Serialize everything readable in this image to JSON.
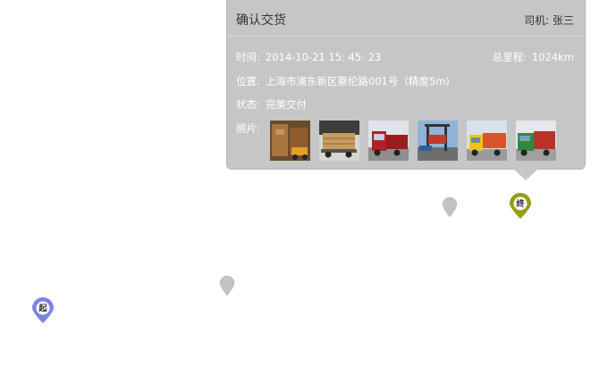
{
  "popup": {
    "title": "确认交货",
    "driver": "司机: 张三",
    "time_label": "时间:",
    "time_value": "2014-10-21  15: 45: 23",
    "mileage_label": "总里程:",
    "mileage_value": "1024km",
    "location_label": "位置:",
    "location_value": "上海市浦东新区蔡伦路001号（精度5m)",
    "status_label": "状态:",
    "status_value": "完美交付",
    "photos_label": "照片:",
    "photos": [
      {
        "icon": "warehouse-loading-photo"
      },
      {
        "icon": "timber-truck-photo"
      },
      {
        "icon": "red-truck-photo"
      },
      {
        "icon": "container-crane-photo"
      },
      {
        "icon": "yellow-truck-photo"
      },
      {
        "icon": "green-truck-photo"
      }
    ]
  },
  "markers": {
    "start": {
      "label": "起",
      "color": "#7b83e6"
    },
    "end": {
      "label": "终",
      "color": "#9a9a16"
    },
    "waypoint_color": "#c2c2c2"
  }
}
